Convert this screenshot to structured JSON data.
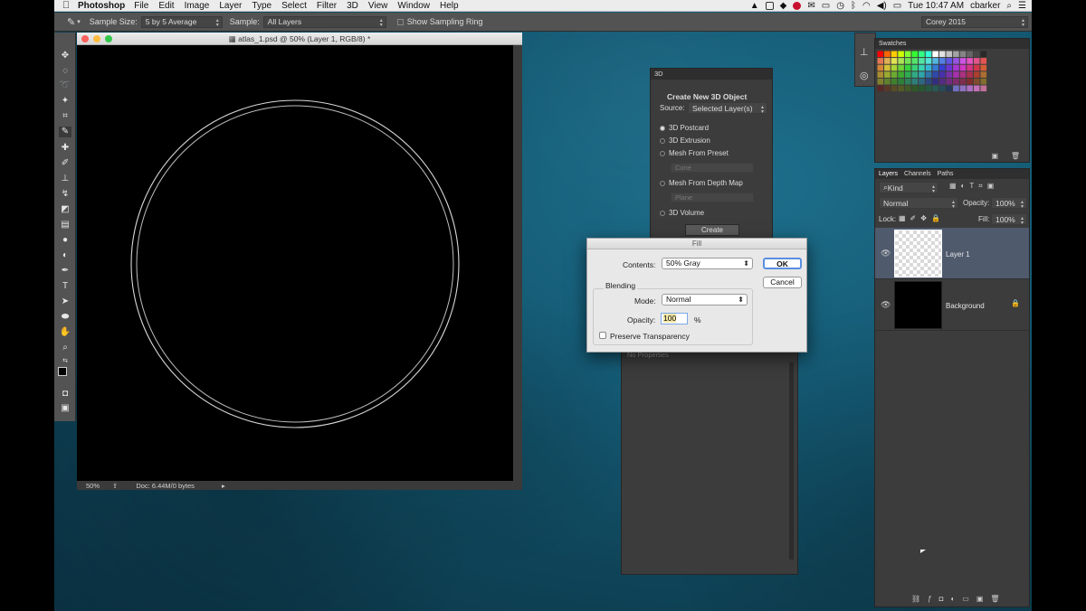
{
  "menubar": {
    "app_name": "Photoshop",
    "items": [
      "File",
      "Edit",
      "Image",
      "Layer",
      "Type",
      "Select",
      "Filter",
      "3D",
      "View",
      "Window",
      "Help"
    ],
    "clock": "Tue 10:47 AM",
    "user": "cbarker"
  },
  "options_bar": {
    "sample_size_label": "Sample Size:",
    "sample_size_value": "5 by 5 Average",
    "sample_label": "Sample:",
    "sample_value": "All Layers",
    "show_ring_label": "Show Sampling Ring",
    "workspace": "Corey 2015"
  },
  "document": {
    "title": "atlas_1.psd @ 50% (Layer 1, RGB/8) *",
    "zoom": "50%",
    "doc_info": "Doc: 6.44M/0 bytes"
  },
  "panel_3d": {
    "tab": "3D",
    "heading": "Create New 3D Object",
    "source_label": "Source:",
    "source_value": "Selected Layer(s)",
    "options": [
      "3D Postcard",
      "3D Extrusion",
      "Mesh From Preset",
      "Mesh From Depth Map",
      "3D Volume"
    ],
    "selected_option": "3D Postcard",
    "preset_value": "Cone",
    "depth_map_value": "Plane",
    "create_label": "Create",
    "no_properties": "No Properties"
  },
  "fill_dialog": {
    "title": "Fill",
    "contents_label": "Contents:",
    "contents_value": "50% Gray",
    "blending_label": "Blending",
    "mode_label": "Mode:",
    "mode_value": "Normal",
    "opacity_label": "Opacity:",
    "opacity_value": "100",
    "opacity_unit": "%",
    "preserve_label": "Preserve Transparency",
    "ok_label": "OK",
    "cancel_label": "Cancel"
  },
  "swatches": {
    "tab": "Swatches"
  },
  "layers_panel": {
    "tabs": [
      "Layers",
      "Channels",
      "Paths"
    ],
    "filter_value": "Kind",
    "blend_mode": "Normal",
    "opacity_label": "Opacity:",
    "opacity_value": "100%",
    "lock_label": "Lock:",
    "fill_label": "Fill:",
    "fill_value": "100%",
    "layers": [
      {
        "name": "Layer 1",
        "selected": true
      },
      {
        "name": "Background",
        "selected": false
      }
    ]
  }
}
